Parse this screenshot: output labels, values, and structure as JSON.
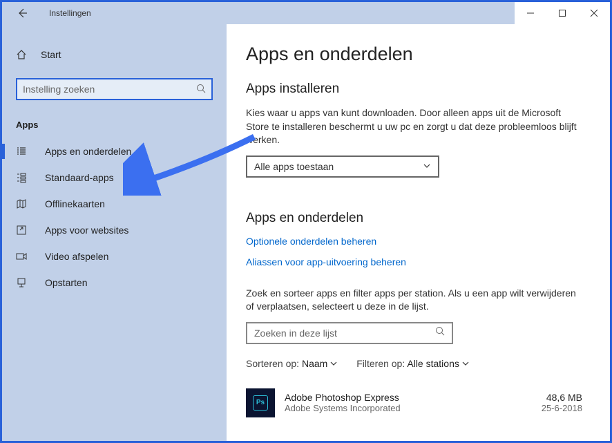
{
  "titlebar": {
    "title": "Instellingen"
  },
  "sidebar": {
    "home_label": "Start",
    "search_placeholder": "Instelling zoeken",
    "section": "Apps",
    "items": [
      {
        "label": "Apps en onderdelen"
      },
      {
        "label": "Standaard-apps"
      },
      {
        "label": "Offlinekaarten"
      },
      {
        "label": "Apps voor websites"
      },
      {
        "label": "Video afspelen"
      },
      {
        "label": "Opstarten"
      }
    ]
  },
  "main": {
    "page_title": "Apps en onderdelen",
    "install_section": "Apps installeren",
    "install_body": "Kies waar u apps van kunt downloaden. Door alleen apps uit de Microsoft Store te installeren beschermt u uw pc en zorgt u dat deze probleemloos blijft werken.",
    "install_dropdown": "Alle apps toestaan",
    "apps_section": "Apps en onderdelen",
    "link_optional": "Optionele onderdelen beheren",
    "link_aliases": "Aliassen voor app-uitvoering beheren",
    "apps_body": "Zoek en sorteer apps en filter apps per station. Als u een app wilt verwijderen of verplaatsen, selecteert u deze in de lijst.",
    "searchlist_placeholder": "Zoeken in deze lijst",
    "sort_label": "Sorteren op:",
    "sort_value": "Naam",
    "filter_label": "Filteren op:",
    "filter_value": "Alle stations",
    "app": {
      "name": "Adobe Photoshop Express",
      "publisher": "Adobe Systems Incorporated",
      "size": "48,6 MB",
      "date": "25-6-2018"
    }
  }
}
